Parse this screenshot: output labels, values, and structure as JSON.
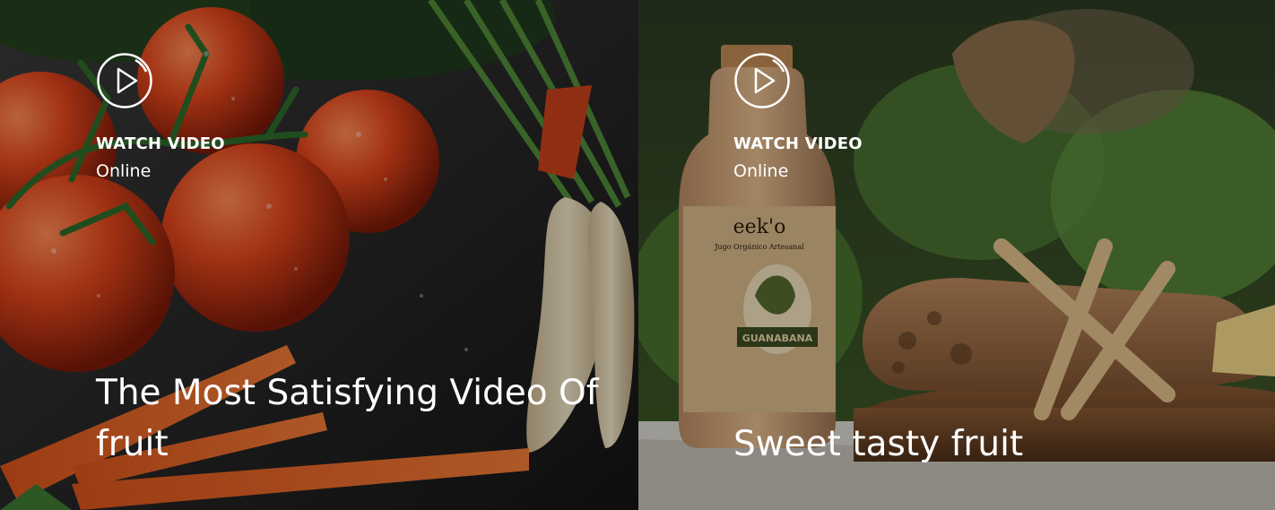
{
  "cards": [
    {
      "watch_label": "WATCH VIDEO",
      "status": "Online",
      "title": "The Most Satisfying Video Of fruit",
      "play_icon": "play-circle-icon",
      "image_subject": "tomatoes-carrots-parsnips"
    },
    {
      "watch_label": "WATCH VIDEO",
      "status": "Online",
      "title": "Sweet tasty fruit",
      "play_icon": "play-circle-icon",
      "image_subject": "juice-bottle-bread"
    }
  ],
  "product": {
    "brand": "eek'o",
    "subtitle": "Jugo Orgánico Artesanal",
    "flavor": "GUANABANA"
  },
  "colors": {
    "text": "#ffffff",
    "overlay": "rgba(0,0,0,0.28)"
  }
}
